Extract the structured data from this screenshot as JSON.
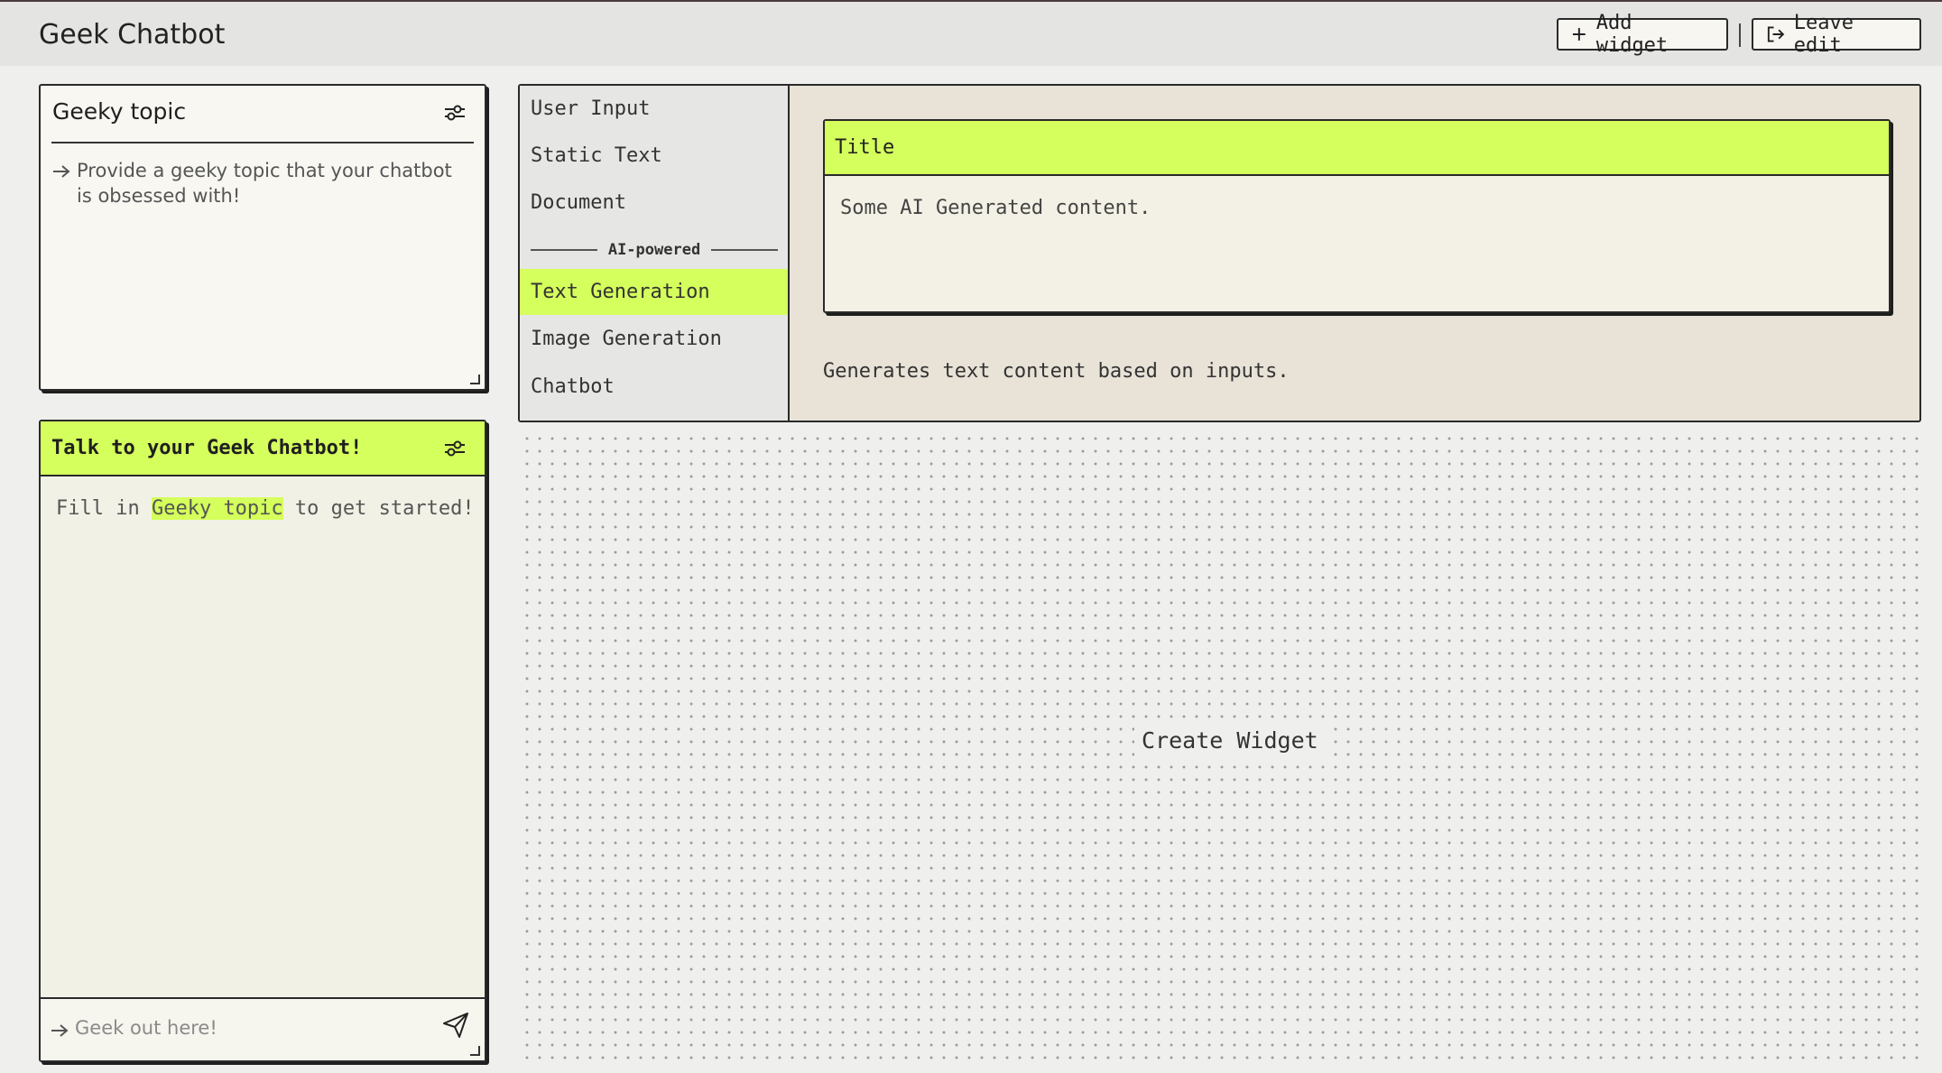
{
  "app": {
    "title": "Geek Chatbot"
  },
  "header": {
    "add_widget": {
      "label": "Add widget",
      "icon": "plus-icon"
    },
    "leave_edit": {
      "label": "Leave edit",
      "icon": "exit-icon"
    }
  },
  "topic_widget": {
    "title": "Geeky topic",
    "description": "Provide a geeky topic that your chatbot is obsessed with!"
  },
  "chat_widget": {
    "title": "Talk to your Geek Chatbot!",
    "message_prefix": "Fill in",
    "message_highlight": "Geeky topic",
    "message_suffix": "to get started!",
    "input_placeholder": "Geek out here!",
    "send_icon": "send-icon"
  },
  "widget_picker": {
    "items": [
      {
        "label": "User Input"
      },
      {
        "label": "Static Text"
      },
      {
        "label": "Document"
      },
      {
        "label": "Text Generation",
        "active": true
      },
      {
        "label": "Image Generation"
      },
      {
        "label": "Chatbot"
      }
    ],
    "divider_label": "AI-powered",
    "preview": {
      "title": "Title",
      "body": "Some AI Generated content."
    },
    "description": "Generates text content based on inputs."
  },
  "canvas": {
    "create_label": "Create Widget"
  },
  "colors": {
    "accent": "#d5ff5c",
    "border": "#2a2a2a",
    "panel_bg": "#f8f7f2",
    "header_bg": "#e4e4e2",
    "picker_bg": "#e8e2d7"
  }
}
